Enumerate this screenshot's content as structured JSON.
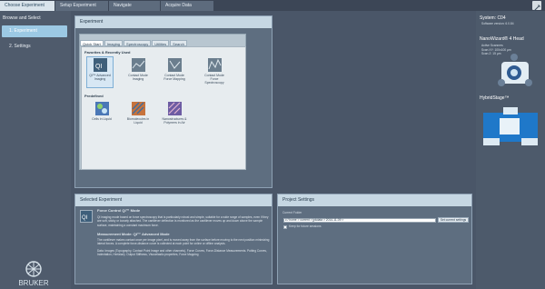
{
  "tabs": [
    {
      "label": "Choose Experiment",
      "active": true
    },
    {
      "label": "Setup Experiment",
      "active": false
    },
    {
      "label": "Navigate",
      "active": false
    },
    {
      "label": "Acquire Data",
      "active": false
    }
  ],
  "toolbar": {
    "tool_icon": "wrench-icon"
  },
  "left_nav": {
    "title": "Browse and Select",
    "items": [
      "1. Experiment",
      "2. Settings"
    ],
    "logo": "BRUKER"
  },
  "experiment_panel": {
    "title": "Experiment",
    "tabs": [
      "Quick Start",
      "Imaging",
      "Spectroscopy",
      "Utilities",
      "Search"
    ],
    "section_favorites": "Favorites & Recently Used",
    "favorites": [
      {
        "icon": "qi-icon",
        "label": "QI™ Advanced Imaging"
      },
      {
        "icon": "contact-mode-icon",
        "label": "Contact Mode Imaging"
      },
      {
        "icon": "contact-mode-force-icon",
        "label": "Contact Mode Force Mapping"
      },
      {
        "icon": "contact-mode-spectroscopy-icon",
        "label": "Contact Mode Force Spectroscopy"
      }
    ],
    "section_predefined": "Predefined",
    "predefined": [
      {
        "icon": "cells-icon",
        "label": "Cells in Liquid"
      },
      {
        "icon": "biomolecules-icon",
        "label": "Biomolecules in Liquid"
      },
      {
        "icon": "nanostructures-icon",
        "label": "Nanostructures & Polymers in Air"
      }
    ]
  },
  "selected_experiment": {
    "title": "Selected Experiment",
    "mode_title": "Force Control QI™ Mode",
    "mode_desc": "QI imaging mode based on force spectroscopy that is particularly robust and simple, suitable for a wide range of samples, even if they are soft, sticky or loosely attached. The cantilever deflection is monitored as the cantilever moves up and down above the sample surface, maintaining a constant maximum force.",
    "measurement_title": "Measurement Mode: QI™ Advanced Mode",
    "measurement_desc": "The cantilever makes contact once per image pixel, and is moved away from the surface before moving to the next position minimizing lateral forces. A complete force-distance curve is collected at each point for online or offline analysis.",
    "data_desc": "Data: Images (Topography, Contact Point Image and other channels), Force Curves, Force-Distance Measurements. Putting Curves, Indentation, Hertzian). Output Stiffness, Viscoelastic properties, Force Mapping"
  },
  "project_settings": {
    "title": "Project Settings",
    "current_folder_label": "Current Folder",
    "current_folder_value": "c:/ home > current > jpkdata > 2014-11-09 >",
    "button_label": "Set current settings",
    "checkbox_label": "Keep for future sessions"
  },
  "system": {
    "title": "System: C04",
    "software": "Software version: 6.0.84",
    "head_title": "NanoWizard® 4 Head",
    "head_lines": [
      "Active Scanners",
      "Scan XY: 100x100 µm",
      "Scan Z: 15 µm"
    ],
    "stage_title": "HybridStage™"
  },
  "colors": {
    "accent": "#9cc9e4",
    "background": "#4a5668",
    "panel": "#5e6e80",
    "header": "#c6d7e3"
  }
}
